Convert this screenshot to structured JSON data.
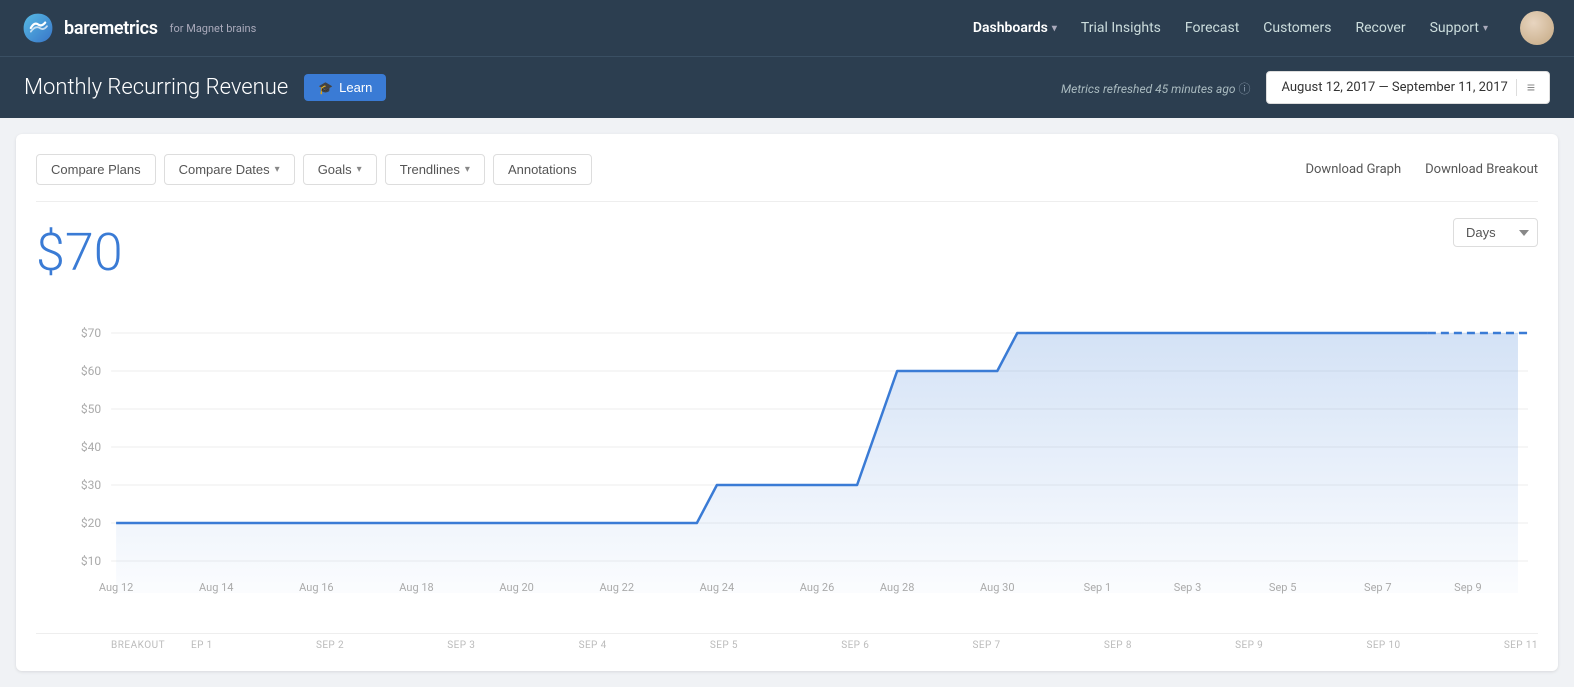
{
  "brand": {
    "name": "baremetrics",
    "sub": "for Magnet brains",
    "logo_alt": "baremetrics logo"
  },
  "navbar": {
    "items": [
      {
        "label": "Dashboards",
        "has_arrow": true,
        "active": true
      },
      {
        "label": "Trial Insights",
        "has_arrow": false,
        "active": false
      },
      {
        "label": "Forecast",
        "has_arrow": false,
        "active": false
      },
      {
        "label": "Customers",
        "has_arrow": false,
        "active": false
      },
      {
        "label": "Recover",
        "has_arrow": false,
        "active": false
      },
      {
        "label": "Support",
        "has_arrow": true,
        "active": false
      }
    ]
  },
  "page_header": {
    "title": "Monthly Recurring Revenue",
    "learn_label": "Learn",
    "metrics_refresh": "Metrics refreshed",
    "refresh_time": "45 minutes ago",
    "date_range": "August 12, 2017  —  September 11, 2017"
  },
  "toolbar": {
    "compare_plans": "Compare Plans",
    "compare_dates": "Compare Dates",
    "goals": "Goals",
    "trendlines": "Trendlines",
    "annotations": "Annotations",
    "download_graph": "Download Graph",
    "download_breakout": "Download Breakout"
  },
  "chart": {
    "metric_value": "$70",
    "days_select_label": "Days",
    "y_labels": [
      "$70",
      "$60",
      "$50",
      "$40",
      "$30",
      "$20",
      "$10"
    ],
    "x_labels": [
      "Aug 12",
      "Aug 14",
      "Aug 16",
      "Aug 18",
      "Aug 20",
      "Aug 22",
      "Aug 24",
      "Aug 26",
      "Aug 28",
      "Aug 30",
      "Sep 1",
      "Sep 3",
      "Sep 5",
      "Sep 7",
      "Sep 9"
    ],
    "breakout_labels": [
      "BREAKOUT",
      "EP 1",
      "SEP 2",
      "SEP 3",
      "SEP 4",
      "SEP 5",
      "SEP 6",
      "SEP 7",
      "SEP 8",
      "SEP 9",
      "SEP 10",
      "SEP 11"
    ]
  },
  "colors": {
    "primary_blue": "#3a7bd5",
    "nav_bg": "#2c3e50",
    "chart_line": "#3a7bd5",
    "chart_fill_start": "rgba(58,123,213,0.25)",
    "chart_fill_end": "rgba(58,123,213,0.02)"
  }
}
